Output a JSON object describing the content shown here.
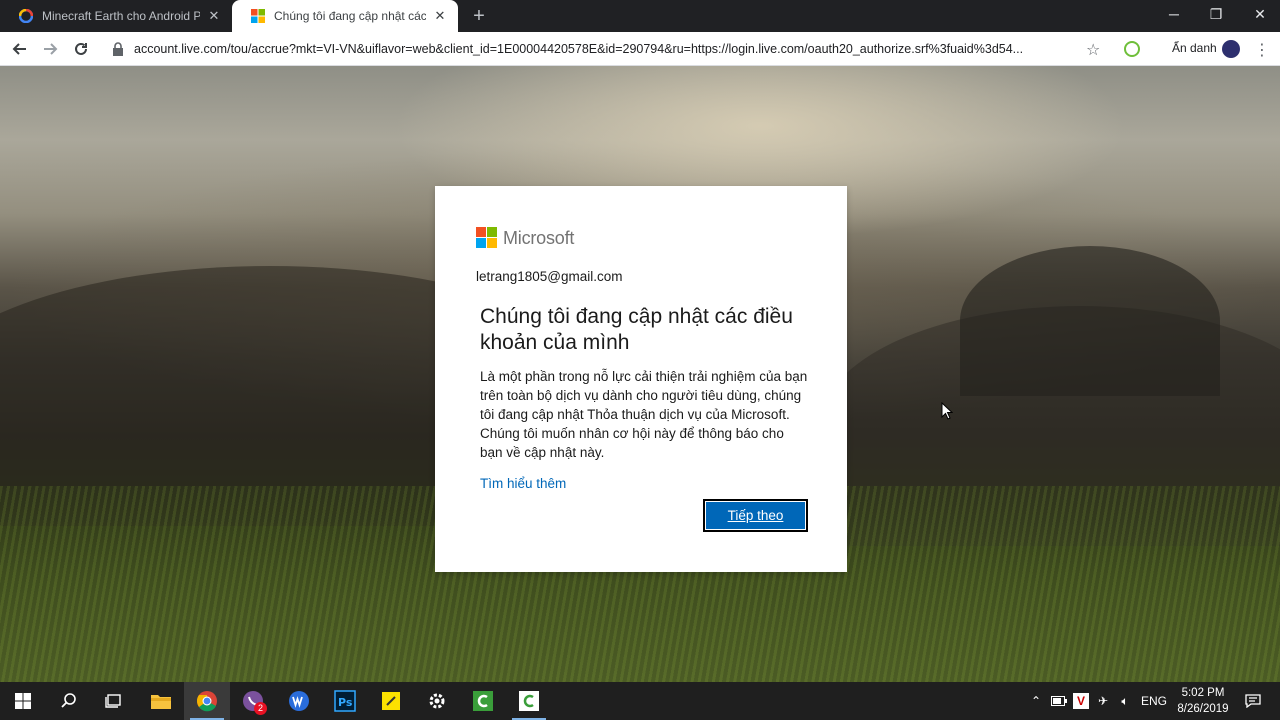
{
  "browser": {
    "tabs": [
      {
        "title": "Minecraft Earth cho Android Pre",
        "active": false
      },
      {
        "title": "Chúng tôi đang cập nhật các điề",
        "active": true
      }
    ],
    "url": "account.live.com/tou/accrue?mkt=VI-VN&uiflavor=web&client_id=1E00004420578E&id=290794&ru=https://login.live.com/oauth20_authorize.srf%3fuaid%3d54...",
    "profile_label": "Ẩn danh"
  },
  "dialog": {
    "brand": "Microsoft",
    "account": "letrang1805@gmail.com",
    "heading": "Chúng tôi đang cập nhật các điều khoản của mình",
    "body": "Là một phần trong nỗ lực cải thiện trải nghiệm của bạn trên toàn bộ dịch vụ dành cho người tiêu dùng, chúng tôi đang cập nhật Thỏa thuận dịch vụ của Microsoft. Chúng tôi muốn nhân cơ hội này để thông báo cho bạn về cập nhật này.",
    "learn_more": "Tìm hiểu thêm",
    "next_button": "Tiếp theo"
  },
  "taskbar": {
    "viber_badge": "2",
    "language": "ENG",
    "time": "5:02 PM",
    "date": "8/26/2019"
  },
  "colors": {
    "ms_red": "#f25022",
    "ms_green": "#7fba00",
    "ms_blue": "#00a4ef",
    "ms_yellow": "#ffb900",
    "link_blue": "#0067b8"
  }
}
